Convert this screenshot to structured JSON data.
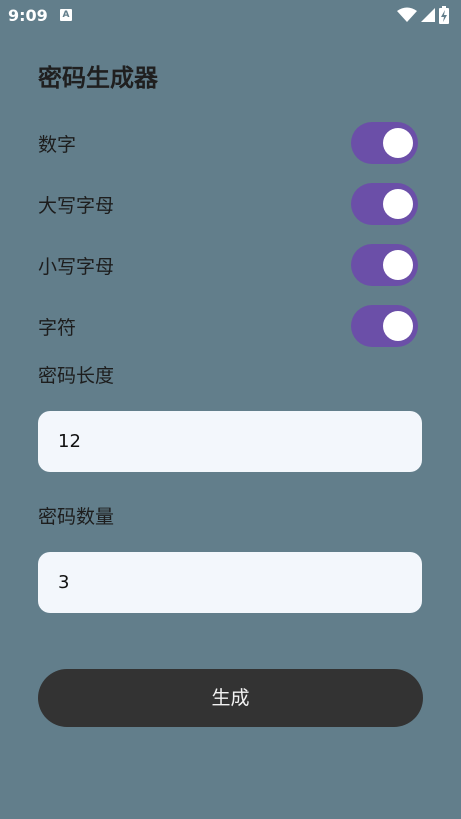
{
  "status_bar": {
    "time": "9:09",
    "notification_badge": "A",
    "icons": [
      "wifi-icon",
      "signal-icon",
      "battery-charging-icon"
    ]
  },
  "app": {
    "title": "密码生成器"
  },
  "options": [
    {
      "label": "数字",
      "enabled": true
    },
    {
      "label": "大写字母",
      "enabled": true
    },
    {
      "label": "小写字母",
      "enabled": true
    },
    {
      "label": "字符",
      "enabled": true
    }
  ],
  "length": {
    "label": "密码长度",
    "value": "12"
  },
  "count": {
    "label": "密码数量",
    "value": "3"
  },
  "generate_button": {
    "label": "生成"
  },
  "colors": {
    "background": "#627e8b",
    "toggle_on": "#6b4fa8",
    "button": "#333333",
    "input_bg": "#f3f7fc"
  }
}
